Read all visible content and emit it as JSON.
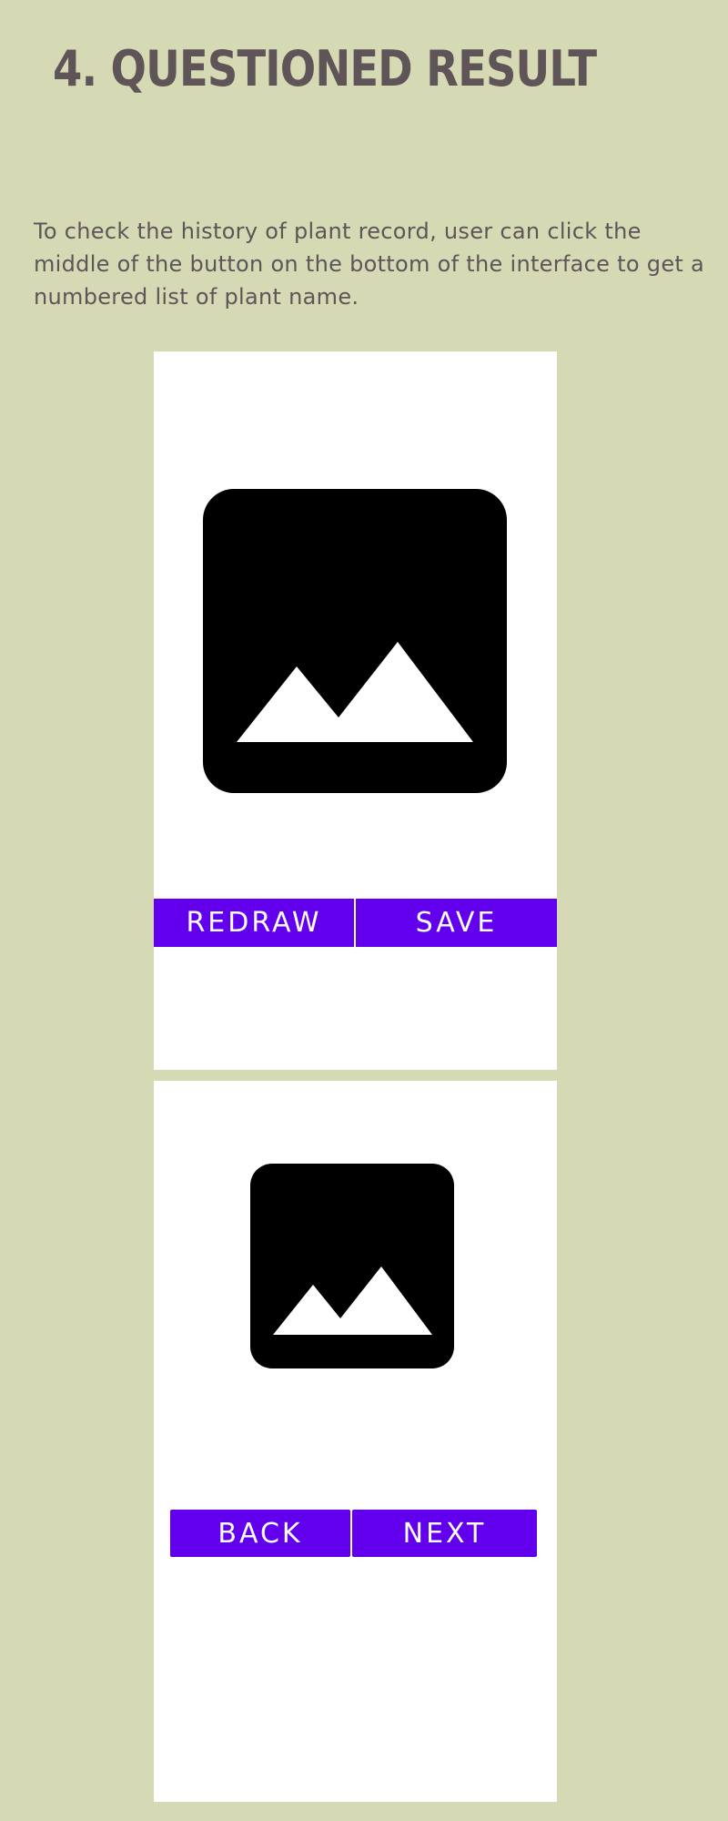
{
  "heading": {
    "title": "4. QUESTIONED RESULT"
  },
  "description": {
    "text": "To check the history of plant record, user can click the middle of the button on the bottom of the interface to get a numbered list of plant name."
  },
  "screens": [
    {
      "image": {
        "icon": "image-placeholder-icon"
      },
      "buttons": {
        "left_label": "REDRAW",
        "right_label": "SAVE"
      }
    },
    {
      "image": {
        "icon": "image-placeholder-icon"
      },
      "buttons": {
        "left_label": "BACK",
        "right_label": "NEXT"
      }
    }
  ],
  "colors": {
    "background": "#d5dab5",
    "heading_text": "#5f5457",
    "screen_background": "#ffffff",
    "button_primary": "#6200ee",
    "button_text": "#ffffff",
    "image_placeholder": "#000000"
  }
}
